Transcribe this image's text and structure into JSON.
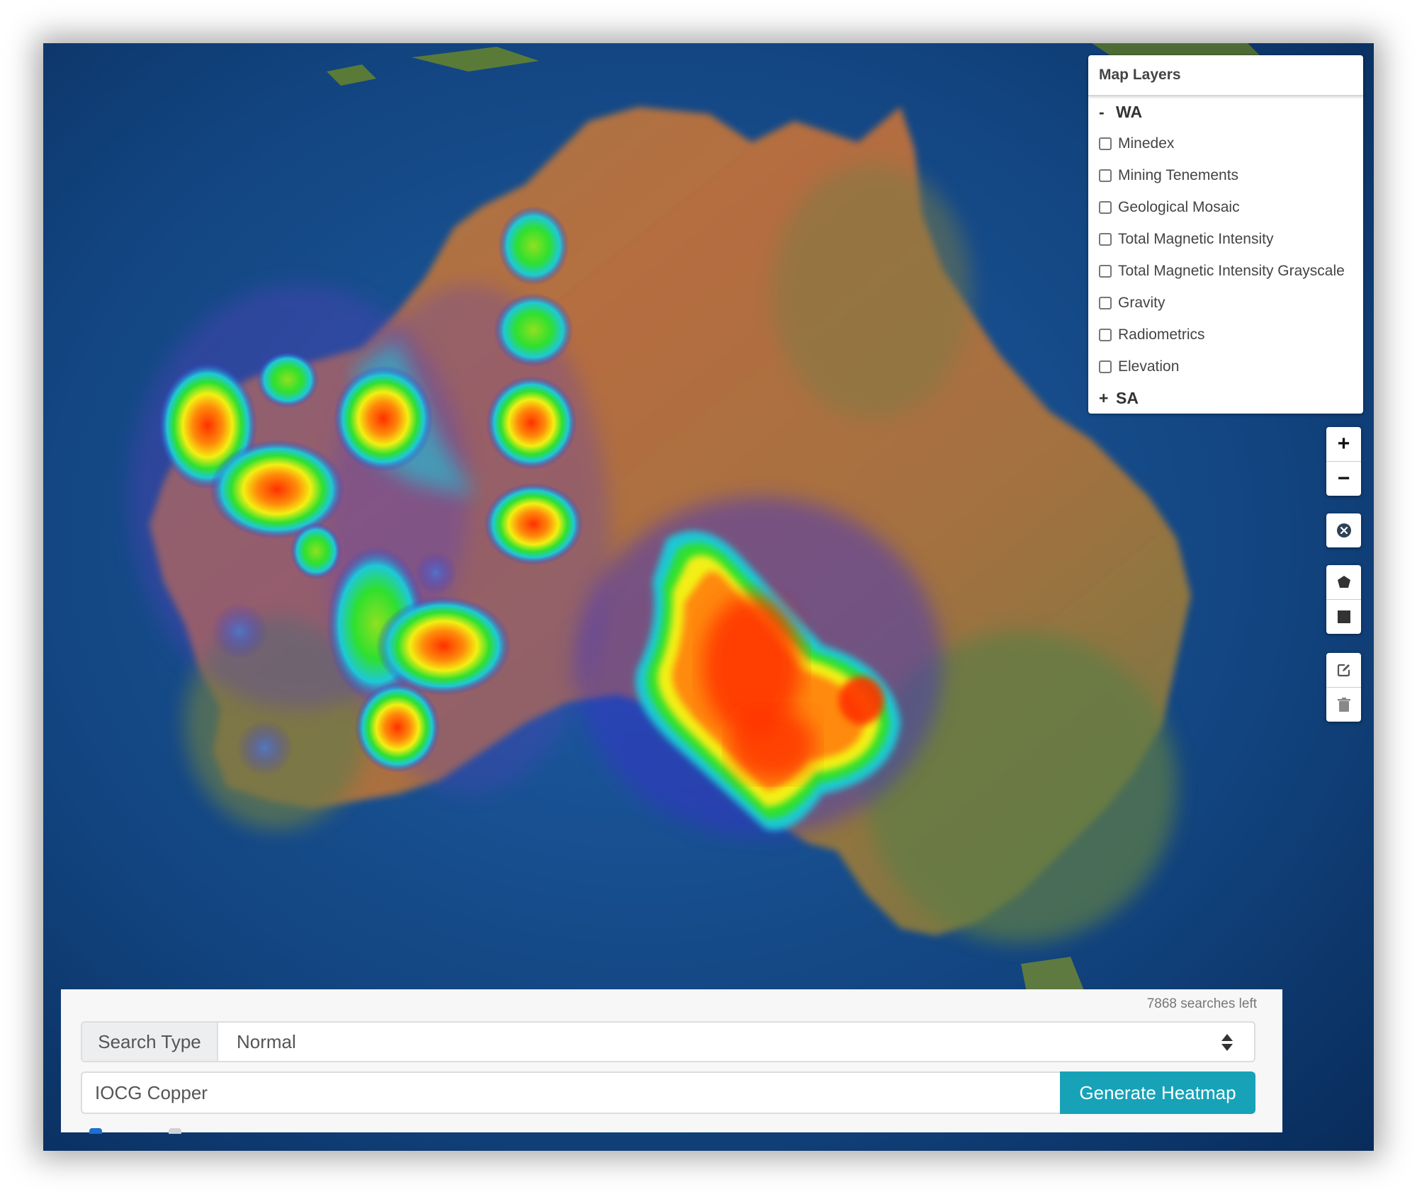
{
  "map": {
    "basemap": "satellite",
    "heatmap_query": "IOCG Copper",
    "heatmap_colors": [
      "#3b2fd0",
      "#1ec8d8",
      "#2fe02f",
      "#f5ef10",
      "#ff9a0a",
      "#ff3000"
    ]
  },
  "layers_panel": {
    "title": "Map Layers",
    "groups": [
      {
        "toggle": "-",
        "name": "WA",
        "expanded": true,
        "items": [
          {
            "label": "Minedex",
            "checked": false
          },
          {
            "label": "Mining Tenements",
            "checked": false
          },
          {
            "label": "Geological Mosaic",
            "checked": false
          },
          {
            "label": "Total Magnetic Intensity",
            "checked": false
          },
          {
            "label": "Total Magnetic Intensity Grayscale",
            "checked": false
          },
          {
            "label": "Gravity",
            "checked": false
          },
          {
            "label": "Radiometrics",
            "checked": false
          },
          {
            "label": "Elevation",
            "checked": false
          }
        ]
      },
      {
        "toggle": "+",
        "name": "SA",
        "expanded": false
      }
    ]
  },
  "map_controls": {
    "zoom_in": "+",
    "zoom_out": "−",
    "icons": [
      "plus-icon",
      "minus-icon",
      "clear-icon",
      "draw-polygon-icon",
      "draw-rectangle-icon",
      "edit-layers-icon",
      "delete-layers-icon"
    ]
  },
  "search_panel": {
    "searches_left": "7868 searches left",
    "search_type_label": "Search Type",
    "search_type_value": "Normal",
    "query_value": "IOCG Copper",
    "generate_button": "Generate Heatmap",
    "accent_color": "#17a2b8"
  }
}
